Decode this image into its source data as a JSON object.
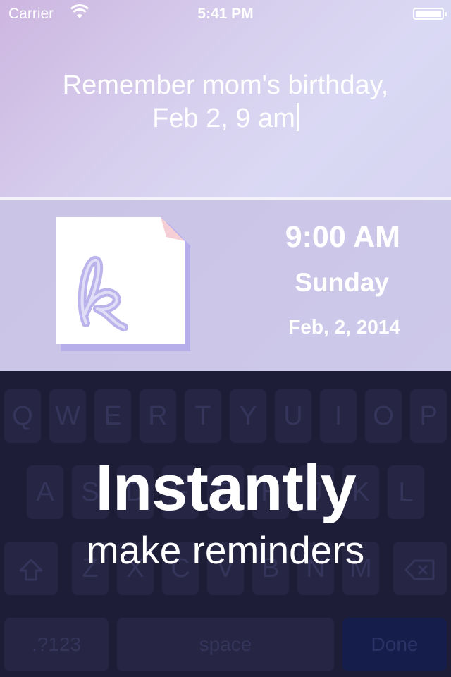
{
  "status_bar": {
    "carrier": "Carrier",
    "time": "5:41 PM",
    "wifi_icon": "wifi-icon",
    "battery_icon": "battery-icon",
    "battery_level": 1.0
  },
  "input": {
    "text_line1": "Remember mom's birthday,",
    "text_line2": "Feb 2, 9 am"
  },
  "result": {
    "icon": "app-logo-icon",
    "time": "9:00 AM",
    "day": "Sunday",
    "date": "Feb, 2, 2014"
  },
  "keyboard": {
    "row1": [
      "Q",
      "W",
      "E",
      "R",
      "T",
      "Y",
      "U",
      "I",
      "O",
      "P"
    ],
    "row2": [
      "A",
      "S",
      "D",
      "F",
      "G",
      "H",
      "J",
      "K",
      "L"
    ],
    "row3": [
      "Z",
      "X",
      "C",
      "V",
      "B",
      "N",
      "M"
    ],
    "shift_icon": "shift-icon",
    "backspace_icon": "backspace-icon",
    "numbers_label": ".?123",
    "space_label": "space",
    "done_label": "Done"
  },
  "caption": {
    "title": "Instantly",
    "subtitle": "make reminders"
  },
  "colors": {
    "keyboard_bg": "#1e1d37",
    "key_bg": "#262543",
    "done_bg": "#151d4b",
    "accent_purple": "#a79ce6"
  }
}
